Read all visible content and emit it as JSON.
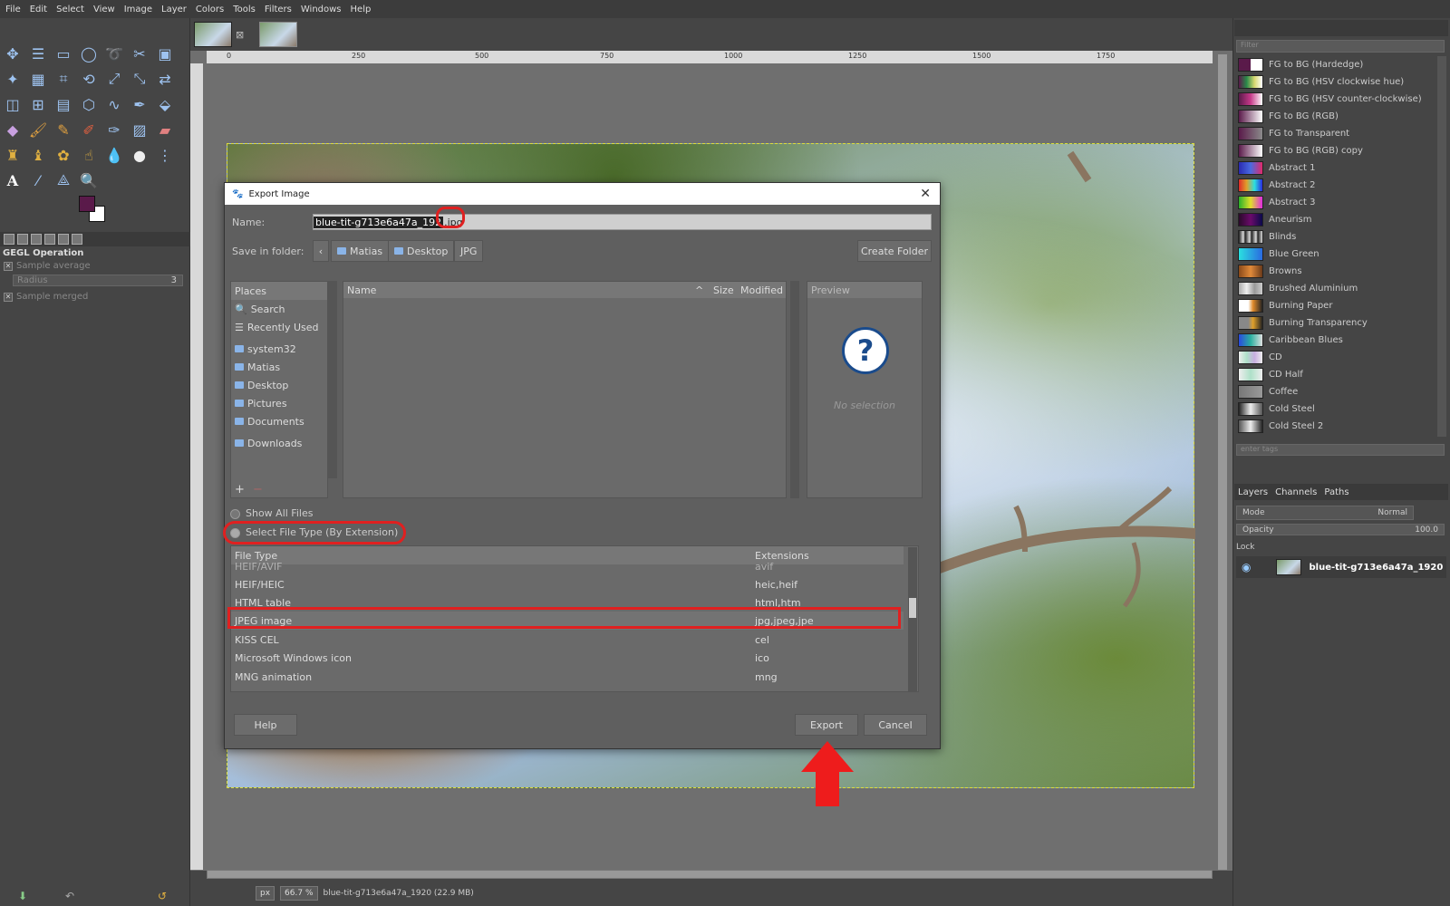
{
  "menubar": {
    "items": [
      "File",
      "Edit",
      "Select",
      "View",
      "Image",
      "Layer",
      "Colors",
      "Tools",
      "Filters",
      "Windows",
      "Help"
    ]
  },
  "toolbox": {
    "options_title": "GEGL Operation",
    "sample_average": "Sample average",
    "radius_label": "Radius",
    "radius_value": "3",
    "sample_merged": "Sample merged",
    "fg_color": "#5a1a4a",
    "bg_color": "#ffffff"
  },
  "ruler": {
    "ticks": [
      "0",
      "250",
      "500",
      "750",
      "1000",
      "1250",
      "1500",
      "1750"
    ]
  },
  "statusbar": {
    "unit": "px",
    "zoom": "66.7 %",
    "file_info": "blue-tit-g713e6a47a_1920 (22.9 MB)"
  },
  "gradients": {
    "filter_placeholder": "Filter",
    "tags_placeholder": "enter tags",
    "items": [
      {
        "label": "FG to BG (Hardedge)",
        "swatch": "linear-gradient(90deg,#5a1a4a 50%,#ffffff 50%)"
      },
      {
        "label": "FG to BG (HSV clockwise hue)",
        "swatch": "linear-gradient(90deg,#5a1a4a,#2a8a4a,#d8d870,#ffffff)"
      },
      {
        "label": "FG to BG (HSV counter-clockwise)",
        "swatch": "linear-gradient(90deg,#5a1a4a,#c83a8a,#ffffff)"
      },
      {
        "label": "FG to BG (RGB)",
        "swatch": "linear-gradient(90deg,#5a1a4a,#ffffff)"
      },
      {
        "label": "FG to Transparent",
        "swatch": "linear-gradient(90deg,#5a1a4a,#8a8a8a)"
      },
      {
        "label": "FG to BG (RGB) copy",
        "swatch": "linear-gradient(90deg,#5a1a4a,#ffffff)"
      },
      {
        "label": "Abstract 1",
        "swatch": "linear-gradient(90deg,#2a2ab0,#4a6ae0,#e02a6a)"
      },
      {
        "label": "Abstract 2",
        "swatch": "linear-gradient(90deg,#e02a2a,#e0a02a,#2ae0e0,#2a2ae0)"
      },
      {
        "label": "Abstract 3",
        "swatch": "linear-gradient(90deg,#2ab02a,#e0e02a,#e02ae0)"
      },
      {
        "label": "Aneurism",
        "swatch": "linear-gradient(90deg,#2a0a2a,#6a0a6a,#0a0a4a)"
      },
      {
        "label": "Blinds",
        "swatch": "repeating-linear-gradient(90deg,#222 0,#ddd 5px,#222 7px)"
      },
      {
        "label": "Blue Green",
        "swatch": "linear-gradient(90deg,#2ae0e0,#2a6ae0)"
      },
      {
        "label": "Browns",
        "swatch": "linear-gradient(90deg,#8a4a1a,#e08a3a,#6a3a1a)"
      },
      {
        "label": "Brushed Aluminium",
        "swatch": "linear-gradient(90deg,#aaa,#eee,#999,#ccc)"
      },
      {
        "label": "Burning Paper",
        "swatch": "linear-gradient(90deg,#fff 40%,#e08a2a 60%,#222)"
      },
      {
        "label": "Burning Transparency",
        "swatch": "linear-gradient(90deg,#888 40%,#e0a02a 60%,#222)"
      },
      {
        "label": "Caribbean Blues",
        "swatch": "linear-gradient(90deg,#2a4ae0,#2ab0a0,#e0e0e0)"
      },
      {
        "label": "CD",
        "swatch": "linear-gradient(90deg,#eee,#aee0c8,#c8aee0,#eee)"
      },
      {
        "label": "CD Half",
        "swatch": "linear-gradient(90deg,#eee,#aee0c8,#eee)"
      },
      {
        "label": "Coffee",
        "swatch": "linear-gradient(90deg,#777,#999)"
      },
      {
        "label": "Cold Steel",
        "swatch": "linear-gradient(90deg,#222,#eee,#555)"
      },
      {
        "label": "Cold Steel 2",
        "swatch": "linear-gradient(90deg,#555,#eee,#222)"
      }
    ]
  },
  "layers": {
    "tabs": [
      "Layers",
      "Channels",
      "Paths"
    ],
    "mode_label": "Mode",
    "mode_value": "Normal",
    "opacity_label": "Opacity",
    "opacity_value": "100.0",
    "lock_label": "Lock",
    "layer_name": "blue-tit-g713e6a47a_1920"
  },
  "dialog": {
    "title": "Export Image",
    "name_label": "Name:",
    "name_selected": "blue-tit-g713e6a47a_192",
    "name_ext": ".jpg",
    "folder_label": "Save in folder:",
    "crumbs": [
      "Matias",
      "Desktop",
      "JPG"
    ],
    "create_folder": "Create Folder",
    "places_header": "Places",
    "places": [
      "Search",
      "Recently Used",
      "system32",
      "Matias",
      "Desktop",
      "Pictures",
      "Documents",
      "Downloads"
    ],
    "files_header": {
      "name": "Name",
      "size": "Size",
      "modified": "Modified"
    },
    "preview_header": "Preview",
    "no_selection": "No selection",
    "show_all": "Show All Files",
    "select_type": "Select File Type (By Extension)",
    "ft_header": {
      "type": "File Type",
      "ext": "Extensions"
    },
    "file_types": [
      {
        "type": "HEIF/AVIF",
        "ext": "avif"
      },
      {
        "type": "HEIF/HEIC",
        "ext": "heic,heif"
      },
      {
        "type": "HTML table",
        "ext": "html,htm"
      },
      {
        "type": "JPEG image",
        "ext": "jpg,jpeg,jpe"
      },
      {
        "type": "KISS CEL",
        "ext": "cel"
      },
      {
        "type": "Microsoft Windows icon",
        "ext": "ico"
      },
      {
        "type": "MNG animation",
        "ext": "mng"
      }
    ],
    "help": "Help",
    "export": "Export",
    "cancel": "Cancel",
    "highlight_color": "#e02020"
  }
}
